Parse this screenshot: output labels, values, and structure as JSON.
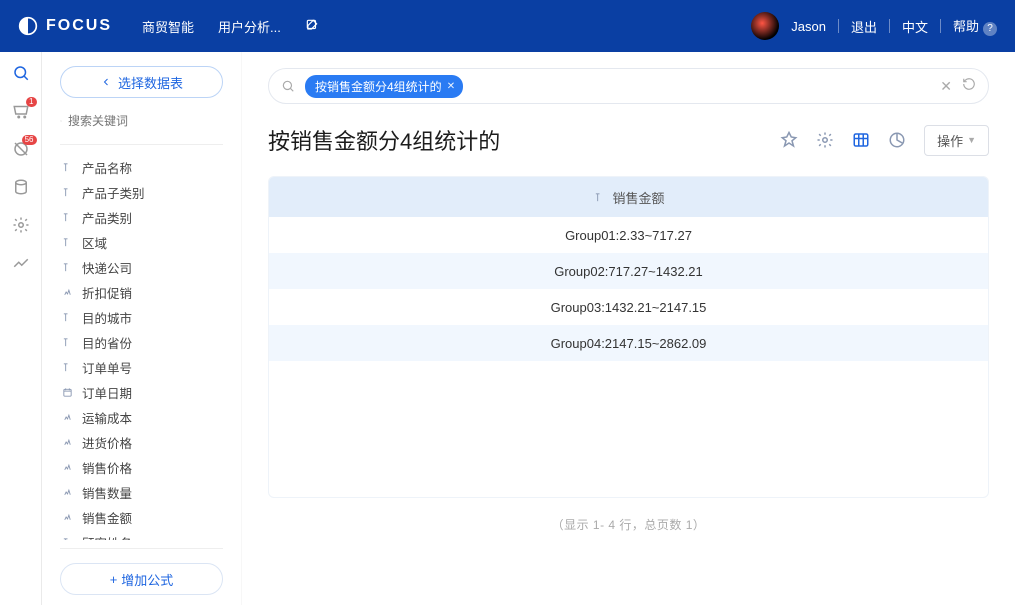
{
  "header": {
    "logo_text": "FOCUS",
    "nav": [
      "商贸智能",
      "用户分析..."
    ],
    "user_name": "Jason",
    "logout": "退出",
    "language": "中文",
    "help": "帮助"
  },
  "rail": {
    "badge1": "1",
    "badge2": "56"
  },
  "sidebar": {
    "choose_table": "选择数据表",
    "search_placeholder": "搜索关键词",
    "fields": [
      {
        "type": "T",
        "label": "产品名称"
      },
      {
        "type": "T",
        "label": "产品子类别"
      },
      {
        "type": "T",
        "label": "产品类别"
      },
      {
        "type": "T",
        "label": "区域"
      },
      {
        "type": "T",
        "label": "快递公司"
      },
      {
        "type": "N",
        "label": "折扣促销"
      },
      {
        "type": "T",
        "label": "目的城市"
      },
      {
        "type": "T",
        "label": "目的省份"
      },
      {
        "type": "T",
        "label": "订单单号"
      },
      {
        "type": "D",
        "label": "订单日期"
      },
      {
        "type": "N",
        "label": "运输成本"
      },
      {
        "type": "N",
        "label": "进货价格"
      },
      {
        "type": "N",
        "label": "销售价格"
      },
      {
        "type": "N",
        "label": "销售数量"
      },
      {
        "type": "N",
        "label": "销售金额"
      },
      {
        "type": "T",
        "label": "顾客姓名"
      }
    ],
    "add_formula": "增加公式"
  },
  "main": {
    "query_pill": "按销售金额分4组统计的",
    "page_title": "按销售金额分4组统计的",
    "action_button": "操作",
    "table": {
      "header": "销售金额",
      "rows": [
        "Group01:2.33~717.27",
        "Group02:717.27~1432.21",
        "Group03:1432.21~2147.15",
        "Group04:2147.15~2862.09"
      ]
    },
    "pagination": "（显示 1- 4 行，总页数 1）"
  }
}
